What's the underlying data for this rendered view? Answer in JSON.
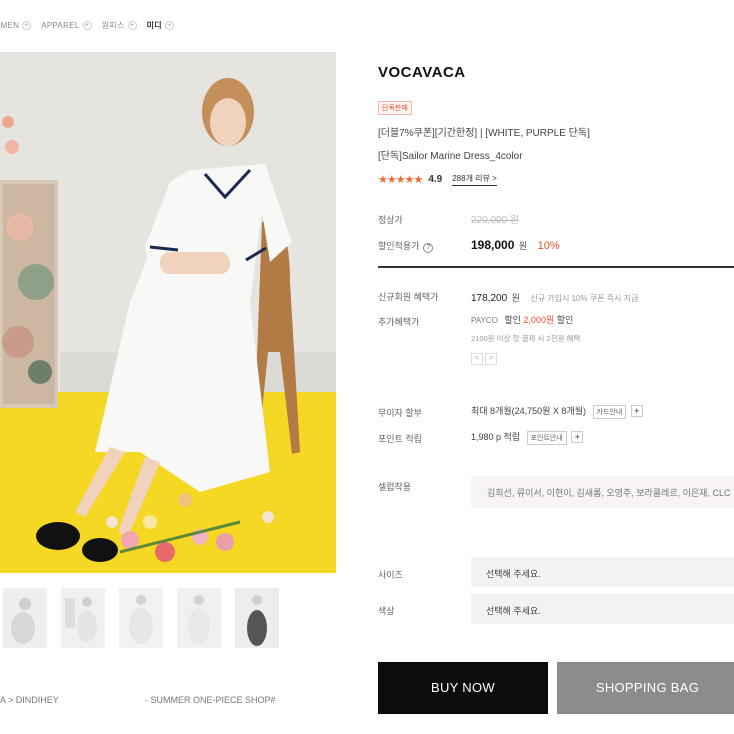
{
  "breadcrumb": [
    "OMEN",
    "APPAREL",
    "원피스",
    "미디"
  ],
  "product": {
    "brand": "VOCAVACA",
    "badge": "단독판매",
    "title_line1": "[더블7%쿠폰][기간한정] | [WHITE, PURPLE 단독]",
    "title_line2": "[단독]Sailor Marine Dress_4color",
    "stars": "★★★★★",
    "rating": "4.9",
    "review_label": "288개 리뷰 >"
  },
  "pricing": {
    "regular_label": "정상가",
    "regular_price": "220,000 원",
    "sale_label": "할인적용가",
    "sale_price": "198,000",
    "won": "원",
    "discount": "10%",
    "member_label": "신규회원 혜택가",
    "member_price": "178,200",
    "member_won": "원",
    "member_note": "신규 가입시 10% 쿠폰 즉시 지급",
    "extra_label": "추가혜택가",
    "payco_prefix": "PAYCO",
    "payco_text_a": "할인",
    "payco_amount": "2,000원",
    "payco_text_b": "할인",
    "payco_note": "2100원 이상 첫 결제 시 2천원 혜택",
    "pager": [
      "<",
      ">"
    ]
  },
  "installment": {
    "label": "무이자 할부",
    "value": "최대 8개월(24,750원 X 8개월)",
    "card_btn": "카드안내",
    "plus": "+"
  },
  "points": {
    "label": "포인트 적립",
    "value": "1,980 p 적립",
    "btn": "포인트안내",
    "plus": "+"
  },
  "celeb": {
    "label": "셀럽착용",
    "names": "김희선, 류이서, 이현이, 김새롬, 오영주, 보라클레르, 이은재, CLC"
  },
  "options": {
    "size_label": "사이즈",
    "size_value": "선택해 주세요.",
    "color_label": "색상",
    "color_value": "선택해 주세요."
  },
  "actions": {
    "buy": "BUY NOW",
    "bag": "SHOPPING BAG"
  },
  "footer": {
    "left": "A > DINDIHEY",
    "mid": "- SUMMER ONE-PIECE SHOP#"
  },
  "colors": {
    "accent": "#e5502e",
    "buy_bg": "#0c0c0c",
    "bag_bg": "#8c8c8c",
    "floor": "#f4d824"
  }
}
